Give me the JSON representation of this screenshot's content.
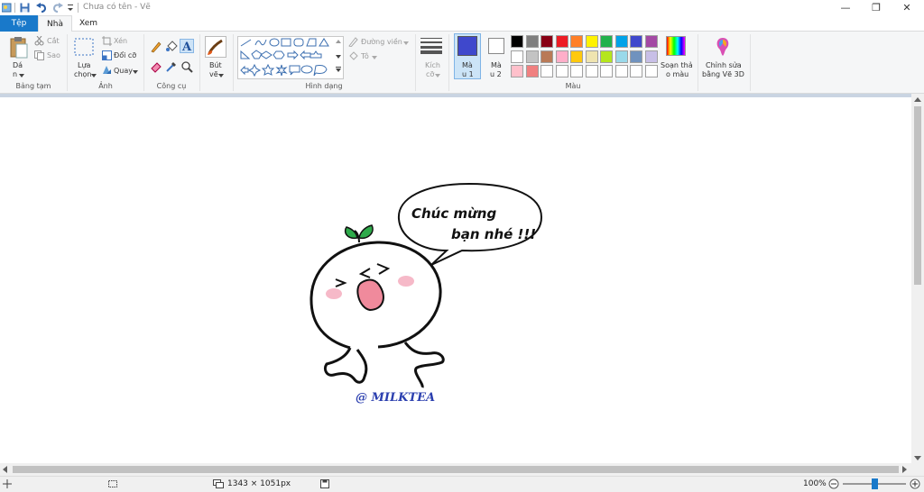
{
  "window": {
    "title": "Chưa có tên - Vẽ",
    "minimize_glyph": "—",
    "restore_glyph": "❐",
    "close_glyph": "✕"
  },
  "tabs": [
    {
      "label": "Tệp",
      "active_file": true
    },
    {
      "label": "Nhà",
      "selected": true
    },
    {
      "label": "Xem"
    }
  ],
  "clipboard": {
    "paste_label": "Dá",
    "paste_label2": "n",
    "cut_label": "Cắt",
    "copy_label": "Sao",
    "group_label": "Bảng tạm"
  },
  "image": {
    "select_label": "Lựa",
    "select_label2": "chọn",
    "crop_label": "Xén",
    "resize_label": "Đổi cỡ",
    "rotate_label": "Quay",
    "group_label": "Ảnh"
  },
  "tools": {
    "group_label": "Công cụ"
  },
  "brushes": {
    "label": "Bút",
    "label2": "vẽ"
  },
  "shapes": {
    "outline_label": "Đường viền",
    "fill_label": "Tô",
    "group_label": "Hình dạng"
  },
  "size": {
    "label": "Kích",
    "label2": "cỡ"
  },
  "colors": {
    "color1_label": "Mà",
    "color1_label2": "u 1",
    "color1": "#3f48cc",
    "color2_label": "Mà",
    "color2_label2": "u 2",
    "color2": "#ffffff",
    "edit_colors_label": "Soạn thả",
    "edit_colors_label2": "o màu",
    "group_label": "Màu",
    "palette_row1": [
      "#000000",
      "#7f7f7f",
      "#880015",
      "#ed1c24",
      "#ff7f27",
      "#fff200",
      "#22b14c",
      "#00a2e8",
      "#3f48cc",
      "#a349a4"
    ],
    "palette_row2": [
      "#ffffff",
      "#c3c3c3",
      "#b97a57",
      "#ffaec9",
      "#ffc90e",
      "#efe4b0",
      "#b5e61d",
      "#99d9ea",
      "#7092be",
      "#c8bfe7"
    ],
    "palette_row3": [
      "#ffc0cb",
      "#f08080",
      "#ffffff",
      "#ffffff",
      "#ffffff",
      "#ffffff",
      "#ffffff",
      "#ffffff",
      "#ffffff",
      "#ffffff"
    ]
  },
  "paint3d": {
    "label": "Chỉnh sửa",
    "label2": "bằng Vẽ 3D"
  },
  "drawing": {
    "bubble_line1": "Chúc mừng",
    "bubble_line2": "bạn nhé !!!",
    "signature": "@ MILKTEA"
  },
  "status": {
    "dimensions": "1343 × 1051px",
    "zoom": "100%",
    "zoom_level": 0.5
  }
}
